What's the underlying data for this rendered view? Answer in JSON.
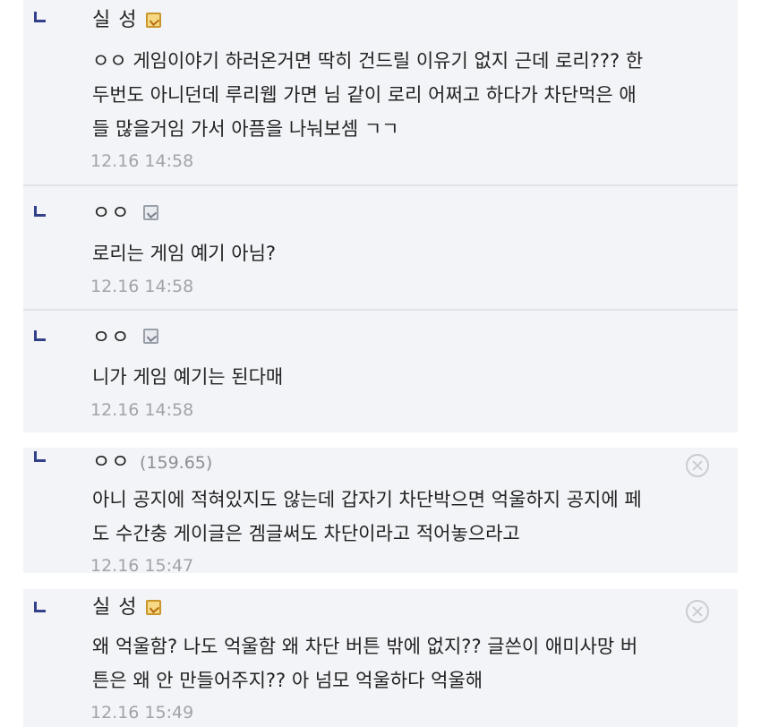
{
  "comments": [
    {
      "nick": "실 성",
      "badge": "fixed-nick-icon",
      "lines": [
        "ㅇㅇ 게임이야기 하러온거면 딱히 건드릴 이유기 없지 근데 로리??? 한",
        "두번도 아니던데 루리웹 가면 님 같이 로리 어쩌고 하다가 차단먹은 애",
        "들 많을거임 가서 아픔을 나눠보셈 ㄱㄱ"
      ],
      "date": "12.16 14:58"
    },
    {
      "nick": "ㅇㅇ",
      "badge": "half-fixed-nick-icon",
      "lines": [
        "로리는 게임 예기 아님?"
      ],
      "date": "12.16 14:58"
    },
    {
      "nick": "ㅇㅇ",
      "badge": "half-fixed-nick-icon",
      "lines": [
        "니가 게임 예기는 된다매"
      ],
      "date": "12.16 14:58"
    },
    {
      "nick": "ㅇㅇ",
      "ip": "(159.65)",
      "lines": [
        "아니 공지에 적혀있지도 않는데 갑자기 차단박으면 억울하지 공지에 페",
        "도 수간충 게이글은 겜글써도 차단이라고 적어놓으라고"
      ],
      "date": "12.16 15:47"
    },
    {
      "nick": "실 성",
      "badge": "fixed-nick-icon",
      "lines": [
        "왜 억울함? 나도 억울함 왜 차단 버튼 밖에 없지?? 글쓴이 애미사망 버",
        "튼은 왜 안 만들어주지?? 아 넘모 억울하다 억울해"
      ],
      "date": "12.16 15:49"
    }
  ]
}
